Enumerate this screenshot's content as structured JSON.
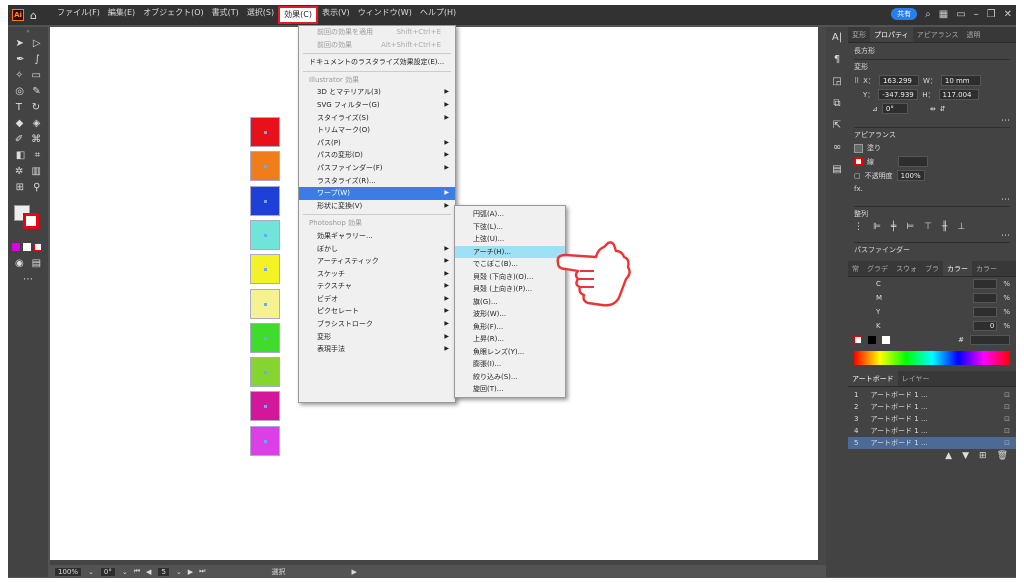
{
  "menubar": {
    "logo": "Ai",
    "items": [
      "ファイル(F)",
      "編集(E)",
      "オブジェクト(O)",
      "書式(T)",
      "選択(S)",
      "効果(C)",
      "表示(V)",
      "ウィンドウ(W)",
      "ヘルプ(H)"
    ],
    "active_index": 5,
    "share": "共有"
  },
  "effect_menu": {
    "top": [
      {
        "label": "前回の効果を適用",
        "shortcut": "Shift+Ctrl+E"
      },
      {
        "label": "前回の効果",
        "shortcut": "Alt+Shift+Ctrl+E"
      }
    ],
    "doc_settings": "ドキュメントのラスタライズ効果設定(E)...",
    "illustrator_header": "Illustrator 効果",
    "illustrator_items": [
      {
        "label": "3D とマテリアル(3)",
        "sub": true
      },
      {
        "label": "SVG フィルター(G)",
        "sub": true
      },
      {
        "label": "スタイライズ(S)",
        "sub": true
      },
      {
        "label": "トリムマーク(O)",
        "sub": false
      },
      {
        "label": "パス(P)",
        "sub": true
      },
      {
        "label": "パスの変形(D)",
        "sub": true
      },
      {
        "label": "パスファインダー(F)",
        "sub": true
      },
      {
        "label": "ラスタライズ(R)...",
        "sub": false
      },
      {
        "label": "ワープ(W)",
        "sub": true,
        "selected": true
      },
      {
        "label": "形状に変換(V)",
        "sub": true
      }
    ],
    "photoshop_header": "Photoshop 効果",
    "photoshop_items": [
      {
        "label": "効果ギャラリー...",
        "sub": false
      },
      {
        "label": "ぼかし",
        "sub": true
      },
      {
        "label": "アーティスティック",
        "sub": true
      },
      {
        "label": "スケッチ",
        "sub": true
      },
      {
        "label": "テクスチャ",
        "sub": true
      },
      {
        "label": "ビデオ",
        "sub": true
      },
      {
        "label": "ピクセレート",
        "sub": true
      },
      {
        "label": "ブラシストローク",
        "sub": true
      },
      {
        "label": "変形",
        "sub": true
      },
      {
        "label": "表現手法",
        "sub": true
      }
    ]
  },
  "warp_submenu": [
    "円弧(A)...",
    "下弦(L)...",
    "上弦(U)...",
    "アーチ(H)...",
    "でこぼこ(B)...",
    "貝殻 (下向き)(O)...",
    "貝殻 (上向き)(P)...",
    "旗(G)...",
    "波形(W)...",
    "魚形(F)...",
    "上昇(R)...",
    "魚眼レンズ(Y)...",
    "膨張(I)...",
    "絞り込み(S)...",
    "旋回(T)..."
  ],
  "warp_selected_index": 3,
  "swatches": [
    "#e8101a",
    "#f07d1a",
    "#1f3fd9",
    "#6fe4d8",
    "#f2f225",
    "#f5f28f",
    "#3fdc2c",
    "#86d430",
    "#d3169a",
    "#dc3fe6"
  ],
  "props": {
    "tabs": [
      "変形",
      "プロパティ",
      "アピアランス",
      "透明"
    ],
    "active_tab": 1,
    "object_type": "長方形",
    "transform_label": "変形",
    "x_label": "X：",
    "x": "163.299",
    "w_label": "W：",
    "w": "10 mm",
    "y_label": "Y：",
    "y": "-347.939",
    "h_label": "H：",
    "h": "117.004",
    "angle": "0°",
    "appearance_label": "アピアランス",
    "fill_label": "塗り",
    "stroke_label": "線",
    "opacity_label": "不透明度",
    "opacity": "100%",
    "fx": "fx.",
    "align_label": "整列",
    "pathfinder_label": "パスファインダー",
    "color_tabs": [
      "常",
      "グラデ",
      "スウォ",
      "ブラ",
      "カラー",
      "カラー"
    ],
    "active_color_tab": 4,
    "cmyk": [
      {
        "k": "C",
        "v": ""
      },
      {
        "k": "M",
        "v": ""
      },
      {
        "k": "Y",
        "v": ""
      },
      {
        "k": "K",
        "v": "0"
      }
    ],
    "pct": "%",
    "hash": "#",
    "artboard_tabs": [
      "アートボード",
      "レイヤー"
    ],
    "artboards": [
      {
        "n": "1",
        "name": "アートボード 1 ..."
      },
      {
        "n": "2",
        "name": "アートボード 1 ..."
      },
      {
        "n": "3",
        "name": "アートボード 1 ..."
      },
      {
        "n": "4",
        "name": "アートボード 1 ..."
      },
      {
        "n": "5",
        "name": "アートボード 1 ..."
      }
    ],
    "active_artboard": 4
  },
  "status": {
    "zoom": "100%",
    "rotate": "0°",
    "page": "5",
    "mode": "選択"
  }
}
